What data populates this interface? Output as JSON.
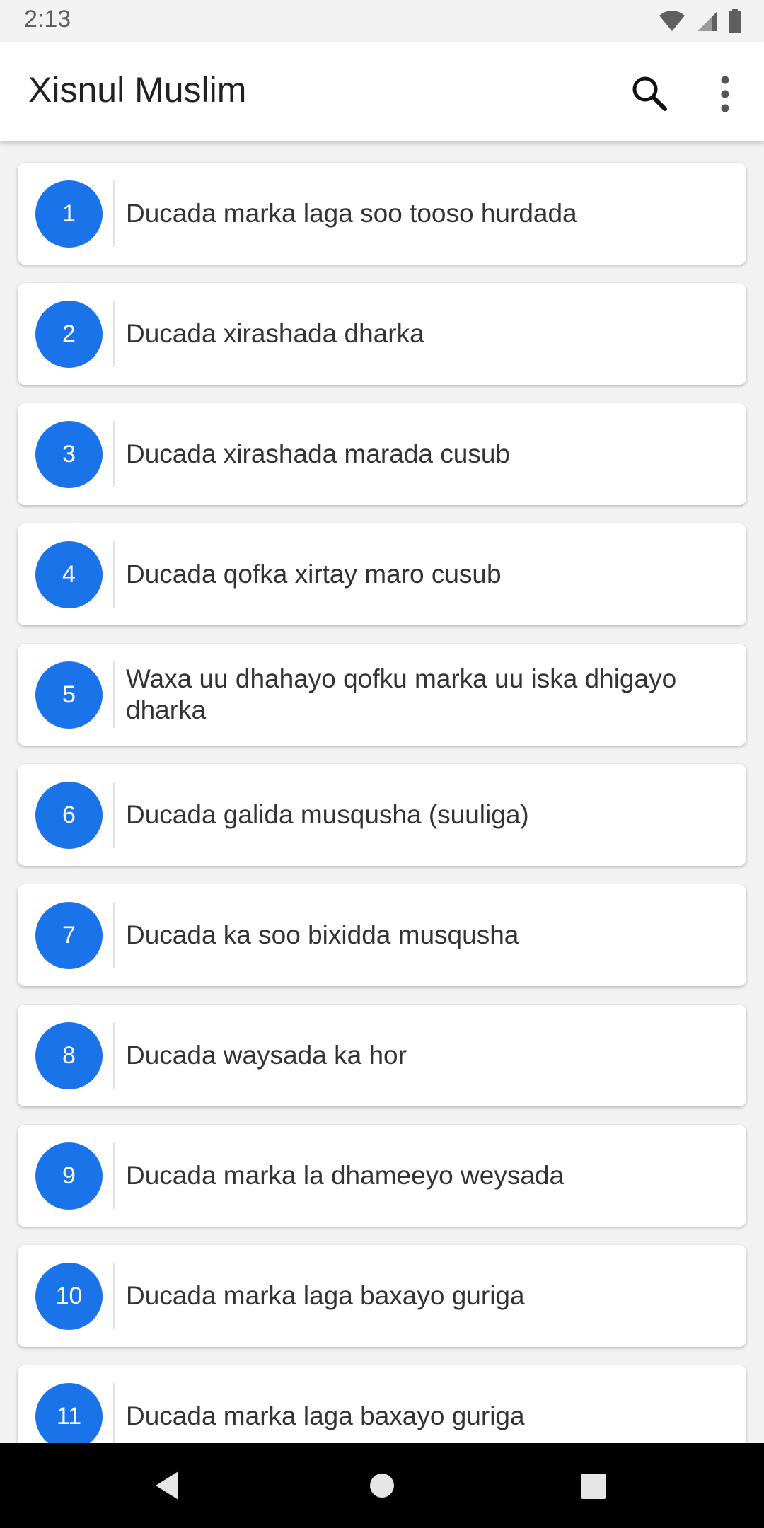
{
  "status_bar": {
    "time": "2:13"
  },
  "app_bar": {
    "title": "Xisnul Muslim"
  },
  "items": [
    {
      "number": "1",
      "label": "Ducada marka laga soo tooso hurdada"
    },
    {
      "number": "2",
      "label": "Ducada xirashada dharka"
    },
    {
      "number": "3",
      "label": "Ducada xirashada marada cusub"
    },
    {
      "number": "4",
      "label": "Ducada qofka xirtay maro cusub"
    },
    {
      "number": "5",
      "label": "Waxa uu dhahayo qofku marka uu iska dhigayo dharka"
    },
    {
      "number": "6",
      "label": "Ducada galida musqusha (suuliga)"
    },
    {
      "number": "7",
      "label": "Ducada ka soo bixidda musqusha"
    },
    {
      "number": "8",
      "label": "Ducada waysada ka hor"
    },
    {
      "number": "9",
      "label": "Ducada marka la dhameeyo weysada"
    },
    {
      "number": "10",
      "label": "Ducada marka laga baxayo guriga"
    },
    {
      "number": "11",
      "label": "Ducada marka laga baxayo guriga"
    }
  ],
  "colors": {
    "accent": "#1a73e8",
    "nav_bar": "#000000"
  }
}
